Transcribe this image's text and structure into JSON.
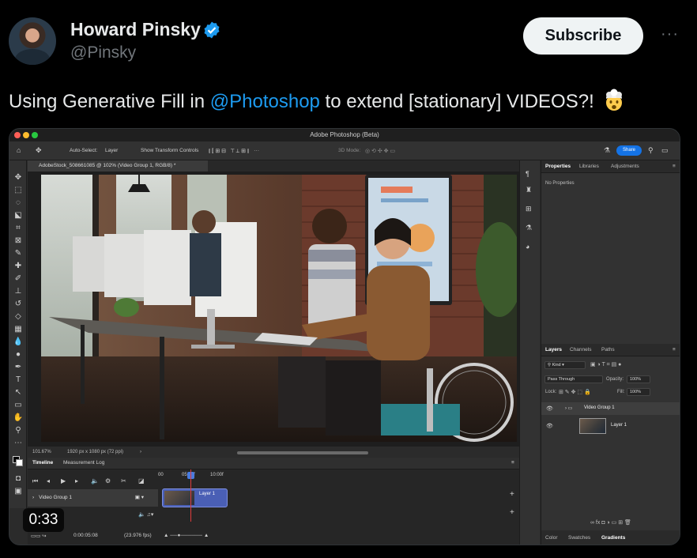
{
  "tweet": {
    "author_name": "Howard Pinsky",
    "handle": "@Pinsky",
    "subscribe_label": "Subscribe",
    "more_label": "···",
    "text_before": "Using Generative Fill in ",
    "mention": "@Photoshop",
    "text_after": " to extend [stationary] VIDEOS?!",
    "emoji": "exploding-head-emoji",
    "video_time": "0:33"
  },
  "photoshop": {
    "window_title": "Adobe Photoshop (Beta)",
    "options_bar": {
      "auto_select_label": "Auto-Select:",
      "auto_select_value": "Layer",
      "transform_label": "Show Transform Controls",
      "mode_label": "3D Mode:",
      "share_label": "Share"
    },
    "doc_tab": "AdobeStock_508661085 @ 102% (Video Group 1, RGB/8) *",
    "status": {
      "zoom": "101.67%",
      "doc_size": "1920 px x 1080 px (72 ppi)"
    },
    "timeline": {
      "tabs": [
        "Timeline",
        "Measurement Log"
      ],
      "ruler": [
        "00",
        "05:00f",
        "10:00f"
      ],
      "track_label": "Video Group 1",
      "clip_label": "Layer 1",
      "timecode": "0:00:05:08",
      "fps": "(23.976 fps)"
    },
    "properties": {
      "tabs": [
        "Properties",
        "Libraries",
        "Adjustments"
      ],
      "empty_text": "No Properties"
    },
    "layers": {
      "tabs": [
        "Layers",
        "Channels",
        "Paths"
      ],
      "filter_label": "Kind",
      "blend_mode": "Pass Through",
      "opacity_label": "Opacity:",
      "opacity_value": "100%",
      "lock_label": "Lock:",
      "fill_label": "Fill:",
      "fill_value": "100%",
      "items": [
        {
          "name": "Video Group 1"
        },
        {
          "name": "Layer 1"
        }
      ]
    },
    "bottom_tabs": [
      "Color",
      "Swatches",
      "Gradients"
    ]
  },
  "colors": {
    "background": "#000000",
    "accent": "#1d9bf0",
    "ps_panel": "#323232",
    "share_blue": "#1473e6"
  }
}
